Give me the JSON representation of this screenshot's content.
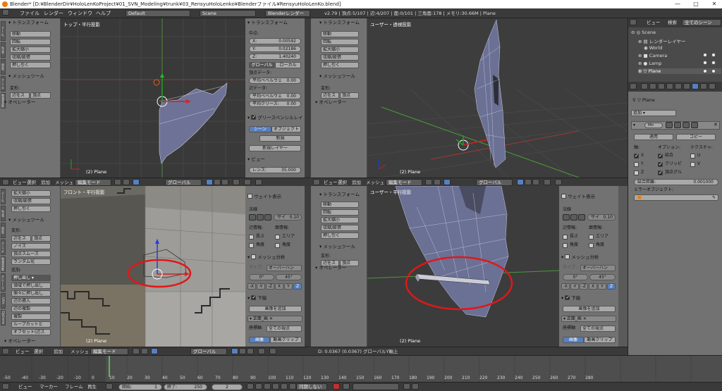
{
  "window": {
    "title": "Blender* [D:¥BlenderDir¥HoloLenKoProject¥01_SVN_Modeling¥trunk¥03_RensyuHoloLenko¥Blenderファイル¥RensyuHoloLenKo.blend]",
    "controls": [
      "—",
      "□",
      "✕"
    ]
  },
  "infobar": {
    "menus": [
      "ファイル",
      "レンダー",
      "ウィンドウ",
      "ヘルプ"
    ],
    "layout": "Default",
    "scene": "Scene",
    "engine": "Blenderレンダー",
    "stats": "v2.79 | 頂点:5/107 | 辺:4/207 | 面:0/101 | 三角面:178 | メモリ:30.66M | Plane"
  },
  "toolshelf": {
    "transform_title": "トランスフォーム",
    "transform_buttons": [
      "移動",
      "回転",
      "拡大縮小",
      "収縮/膨張",
      "押し引く"
    ],
    "mesh_tools_title": "メッシュツール",
    "deform_label": "変形:",
    "deform_buttons": [
      "辺をス",
      "頂点"
    ],
    "deform_buttons_full": [
      "辺をス",
      "頂点",
      "ノイズ",
      "頂点スムーズ",
      "ランダム化"
    ],
    "add_label": "追加:",
    "add_dropdown": "押し出し",
    "add_buttons": [
      "領域で押し出し",
      "個々に押し出し",
      "辺の挿入",
      "辺の複製",
      "複製",
      "ループカットと",
      "オフセット(辺ス"
    ],
    "operator_title": "オペレーター",
    "tabs": [
      "ツール",
      "作成",
      "関係",
      "アニメ",
      "物理演算",
      "グリースペンシル",
      "UVs",
      "Options"
    ]
  },
  "viewports": {
    "top_left": {
      "label": "トップ・平行投影",
      "object": "(2) Plane"
    },
    "top_right": {
      "label": "ユーザー・透視投影",
      "object": "(2) Plane"
    },
    "bottom_left": {
      "label": "フロント・平行投影",
      "object": "(2) Plane"
    },
    "bottom_right": {
      "label": "ユーザー・平行投影",
      "object": "(2) Plane",
      "status": "D: 0.0367 (0.0367) グローバルY軸上"
    }
  },
  "properties_top": {
    "transform_title": "トランスフォーム",
    "median_label": "中点:",
    "x_label": "X:",
    "x_value": "0.00592",
    "y_label": "Y:",
    "y_value": "0.02186",
    "z_label": "Z:",
    "z_value": "1.40240",
    "global_btn": "グローバル",
    "local_btn": "ローカル",
    "vertex_data_label": "頂点データ:",
    "bevel_weight_label": "平均ベベルウェ",
    "bevel_weight_value": "0.00",
    "edge_data_label": "辺データ:",
    "edge_bevel_label": "平均ベベルウェ",
    "edge_bevel_value": "0.00",
    "crease_label": "平均クリース:",
    "crease_value": "0.00",
    "grease_label": "グリースペンシルレイ",
    "scene_btn": "シーン",
    "object_btn": "オブジェクト",
    "new_btn": "新規",
    "new_layer_btn": "新規レイヤー",
    "view_title": "ビュー",
    "lens_label": "レンズ:",
    "lens_value": "35.000"
  },
  "properties_bottom": {
    "weight_label": "ウェイト表示",
    "normals_label": "法線",
    "size_label": "サイ",
    "size_value": "0.10",
    "edge_info_label": "辺情報:",
    "face_info_label": "面情報:",
    "length_label": "長さ",
    "area_label": "エリア",
    "angle_label": "角度",
    "angle2_label": "角度",
    "mesh_analysis_label": "メッシュ分析",
    "type_label": "タイプ:",
    "type_value": "オーバーハン",
    "deg_a": "0°",
    "deg_b": "45°",
    "axes": [
      "-X",
      "-Y",
      "-Z",
      "X",
      "Y",
      "Z"
    ],
    "background_label": "下絵",
    "add_image_btn": "画像を追加",
    "front_label": "正面_画",
    "axis_label": "座標軸",
    "axis_value": "全ての視点",
    "image_btn": "画像",
    "movie_btn": "動画クリップ"
  },
  "view_header": {
    "menus": [
      "ビュー",
      "選択",
      "追加",
      "メッシュ"
    ],
    "mode": "編集モード",
    "orientation": "グローバル"
  },
  "outliner": {
    "menus": [
      "ビュー",
      "検索"
    ],
    "filter": "全てのシーン",
    "items": [
      "Scene",
      "レンダーレイヤー",
      "World",
      "Camera",
      "Lamp",
      "Plane"
    ]
  },
  "modifier": {
    "object_name": "Plane",
    "add_label": "追加",
    "name": "Mir",
    "apply_btn": "適用",
    "copy_btn": "コピー",
    "axis_label": "軸:",
    "options_label": "オプション:",
    "texture_label": "テクスチャ:",
    "x": "X",
    "y": "Y",
    "z": "Z",
    "merge": "結合",
    "clipping": "クリッピ",
    "vertex_groups": "頂点グル",
    "u": "U",
    "v": "V",
    "merge_dist_label": "結合距離:",
    "merge_dist_value": "0.001000",
    "mirror_obj_label": "ミラーオブジェクト:"
  },
  "timeline": {
    "ticks": [
      "-50",
      "-40",
      "-30",
      "-20",
      "-10",
      "0",
      "10",
      "20",
      "30",
      "40",
      "50",
      "60",
      "70",
      "80",
      "90",
      "100",
      "110",
      "120",
      "130",
      "140",
      "150",
      "160",
      "170",
      "180",
      "190",
      "200",
      "210",
      "220",
      "230",
      "240",
      "250",
      "260",
      "270",
      "280"
    ],
    "menus": [
      "ビュー",
      "マーカー",
      "フレーム",
      "再生"
    ],
    "start_label": "開始:",
    "start_value": "1",
    "end_label": "終了:",
    "end_value": "250",
    "current_frame": "2",
    "sync": "同期しない"
  },
  "colors": {
    "panel": "#727272",
    "viewport_ortho": "#3c3c3c",
    "accent_blue": "#5680c2",
    "highlight_red": "#e01818"
  }
}
